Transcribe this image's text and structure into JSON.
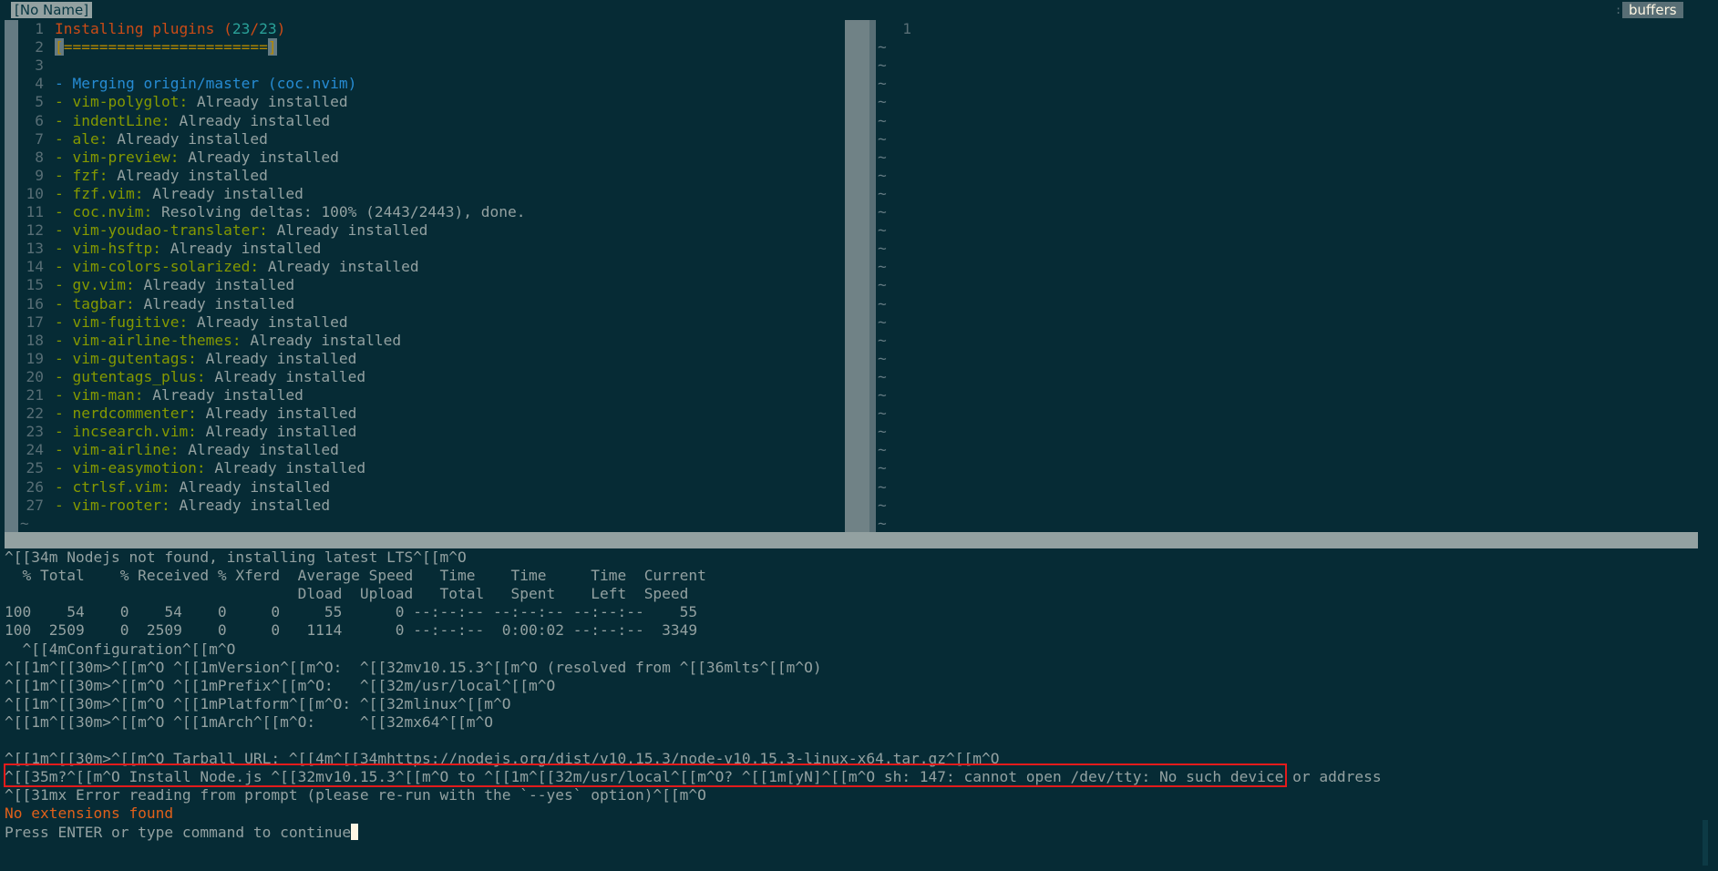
{
  "tabline": {
    "buffer_tab": "[No Name]",
    "separator": ":",
    "buffers_label": "buffers"
  },
  "left_window": {
    "lines": [
      {
        "n": "1",
        "parts": [
          {
            "t": "Installing plugins (",
            "c": "orange"
          },
          {
            "t": "23",
            "c": "cyan"
          },
          {
            "t": "/",
            "c": "orange"
          },
          {
            "t": "23",
            "c": "cyan"
          },
          {
            "t": ")",
            "c": "orange"
          }
        ]
      },
      {
        "n": "2",
        "parts": [
          {
            "t": "[",
            "c": "progress"
          },
          {
            "t": "=======================",
            "c": "progress-fill"
          },
          {
            "t": "]",
            "c": "progress"
          }
        ]
      },
      {
        "n": "3",
        "parts": []
      },
      {
        "n": "4",
        "parts": [
          {
            "t": "- Merging origin/master (coc.nvim)",
            "c": "blue"
          }
        ]
      },
      {
        "n": "5",
        "parts": [
          {
            "t": "- vim-polyglot:",
            "c": "green"
          },
          {
            "t": " Already installed",
            "c": "base"
          }
        ]
      },
      {
        "n": "6",
        "parts": [
          {
            "t": "- indentLine:",
            "c": "green"
          },
          {
            "t": " Already installed",
            "c": "base"
          }
        ]
      },
      {
        "n": "7",
        "parts": [
          {
            "t": "- ale:",
            "c": "green"
          },
          {
            "t": " Already installed",
            "c": "base"
          }
        ]
      },
      {
        "n": "8",
        "parts": [
          {
            "t": "- vim-preview:",
            "c": "green"
          },
          {
            "t": " Already installed",
            "c": "base"
          }
        ]
      },
      {
        "n": "9",
        "parts": [
          {
            "t": "- fzf:",
            "c": "green"
          },
          {
            "t": " Already installed",
            "c": "base"
          }
        ]
      },
      {
        "n": "10",
        "parts": [
          {
            "t": "- fzf.vim:",
            "c": "green"
          },
          {
            "t": " Already installed",
            "c": "base"
          }
        ]
      },
      {
        "n": "11",
        "parts": [
          {
            "t": "- coc.nvim:",
            "c": "green"
          },
          {
            "t": " Resolving deltas: 100% (2443/2443), done.",
            "c": "base"
          }
        ]
      },
      {
        "n": "12",
        "parts": [
          {
            "t": "- vim-youdao-translater:",
            "c": "green"
          },
          {
            "t": " Already installed",
            "c": "base"
          }
        ]
      },
      {
        "n": "13",
        "parts": [
          {
            "t": "- vim-hsftp:",
            "c": "green"
          },
          {
            "t": " Already installed",
            "c": "base"
          }
        ]
      },
      {
        "n": "14",
        "parts": [
          {
            "t": "- vim-colors-solarized:",
            "c": "green"
          },
          {
            "t": " Already installed",
            "c": "base"
          }
        ]
      },
      {
        "n": "15",
        "parts": [
          {
            "t": "- gv.vim:",
            "c": "green"
          },
          {
            "t": " Already installed",
            "c": "base"
          }
        ]
      },
      {
        "n": "16",
        "parts": [
          {
            "t": "- tagbar:",
            "c": "green"
          },
          {
            "t": " Already installed",
            "c": "base"
          }
        ]
      },
      {
        "n": "17",
        "parts": [
          {
            "t": "- vim-fugitive:",
            "c": "green"
          },
          {
            "t": " Already installed",
            "c": "base"
          }
        ]
      },
      {
        "n": "18",
        "parts": [
          {
            "t": "- vim-airline-themes:",
            "c": "green"
          },
          {
            "t": " Already installed",
            "c": "base"
          }
        ]
      },
      {
        "n": "19",
        "parts": [
          {
            "t": "- vim-gutentags:",
            "c": "green"
          },
          {
            "t": " Already installed",
            "c": "base"
          }
        ]
      },
      {
        "n": "20",
        "parts": [
          {
            "t": "- gutentags_plus:",
            "c": "green"
          },
          {
            "t": " Already installed",
            "c": "base"
          }
        ]
      },
      {
        "n": "21",
        "parts": [
          {
            "t": "- vim-man:",
            "c": "green"
          },
          {
            "t": " Already installed",
            "c": "base"
          }
        ]
      },
      {
        "n": "22",
        "parts": [
          {
            "t": "- nerdcommenter:",
            "c": "green"
          },
          {
            "t": " Already installed",
            "c": "base"
          }
        ]
      },
      {
        "n": "23",
        "parts": [
          {
            "t": "- incsearch.vim:",
            "c": "green"
          },
          {
            "t": " Already installed",
            "c": "base"
          }
        ]
      },
      {
        "n": "24",
        "parts": [
          {
            "t": "- vim-airline:",
            "c": "green"
          },
          {
            "t": " Already installed",
            "c": "base"
          }
        ]
      },
      {
        "n": "25",
        "parts": [
          {
            "t": "- vim-easymotion:",
            "c": "green"
          },
          {
            "t": " Already installed",
            "c": "base"
          }
        ]
      },
      {
        "n": "26",
        "parts": [
          {
            "t": "- ctrlsf.vim:",
            "c": "green"
          },
          {
            "t": " Already installed",
            "c": "base"
          }
        ]
      },
      {
        "n": "27",
        "parts": [
          {
            "t": "- vim-rooter:",
            "c": "green"
          },
          {
            "t": " Already installed",
            "c": "base"
          }
        ]
      }
    ],
    "end_marker": "~"
  },
  "right_window": {
    "line_number": "1",
    "filler": "~"
  },
  "messages": [
    {
      "t": "^[[34m Nodejs not found, installing latest LTS^[[m^O",
      "c": "base"
    },
    {
      "t": "  % Total    % Received % Xferd  Average Speed   Time    Time     Time  Current",
      "c": "base"
    },
    {
      "t": "                                 Dload  Upload   Total   Spent    Left  Speed",
      "c": "base"
    },
    {
      "t": "100    54    0    54    0     0     55      0 --:--:-- --:--:-- --:--:--    55",
      "c": "base"
    },
    {
      "t": "100  2509    0  2509    0     0   1114      0 --:--:--  0:00:02 --:--:--  3349",
      "c": "base"
    },
    {
      "t": "  ^[[4mConfiguration^[[m^O",
      "c": "base"
    },
    {
      "t": "^[[1m^[[30m>^[[m^O ^[[1mVersion^[[m^O:  ^[[32mv10.15.3^[[m^O (resolved from ^[[36mlts^[[m^O)",
      "c": "base"
    },
    {
      "t": "^[[1m^[[30m>^[[m^O ^[[1mPrefix^[[m^O:   ^[[32m/usr/local^[[m^O",
      "c": "base"
    },
    {
      "t": "^[[1m^[[30m>^[[m^O ^[[1mPlatform^[[m^O: ^[[32mlinux^[[m^O",
      "c": "base"
    },
    {
      "t": "^[[1m^[[30m>^[[m^O ^[[1mArch^[[m^O:     ^[[32mx64^[[m^O",
      "c": "base"
    },
    {
      "t": "",
      "c": "base"
    },
    {
      "t": "^[[1m^[[30m>^[[m^O Tarball URL: ^[[4m^[[34mhttps://nodejs.org/dist/v10.15.3/node-v10.15.3-linux-x64.tar.gz^[[m^O",
      "c": "base"
    },
    {
      "t": "^[[35m?^[[m^O Install Node.js ^[[32mv10.15.3^[[m^O to ^[[1m^[[32m/usr/local^[[m^O? ^[[1m[yN]^[[m^O sh: 147: cannot open /dev/tty: No such device or address",
      "c": "base"
    },
    {
      "t": "^[[31mx Error reading from prompt (please re-run with the `--yes` option)^[[m^O",
      "c": "base"
    },
    {
      "t": "No extensions found",
      "c": "orange2"
    },
    {
      "t": "Press ENTER or type command to continue",
      "c": "base"
    }
  ],
  "colors": {
    "background": "#062b35",
    "orange": "#cb4b16",
    "green": "#859900",
    "blue": "#268bd2",
    "cyan": "#2aa198",
    "highlight_box": "#e31b1b"
  }
}
